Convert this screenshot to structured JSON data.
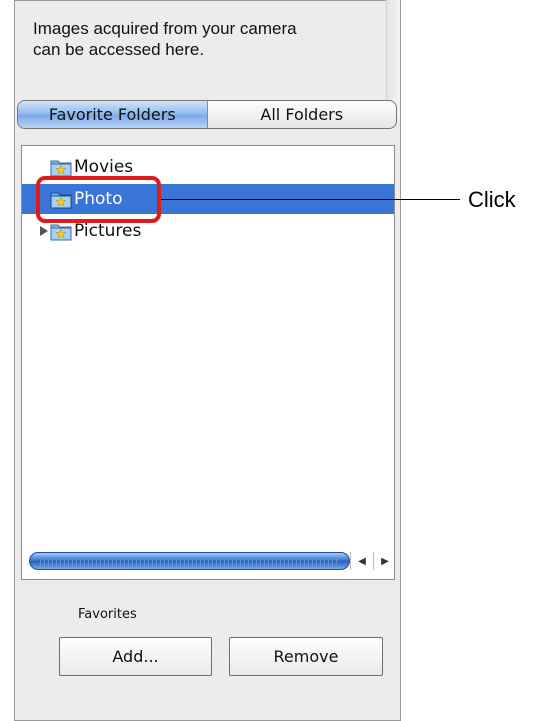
{
  "panel": {
    "info_text_line1": "Images acquired from your camera",
    "info_text_line2": "can be accessed here."
  },
  "tabs": {
    "favorite_folders": "Favorite Folders",
    "all_folders": "All Folders",
    "selected": "Favorite Folders"
  },
  "tree": {
    "items": [
      {
        "label": "Movies",
        "icon": "favorite-folder-icon",
        "selected": false,
        "expandable": false
      },
      {
        "label": "Photo",
        "icon": "favorite-folder-icon",
        "selected": true,
        "expandable": false
      },
      {
        "label": "Pictures",
        "icon": "favorite-folder-icon",
        "selected": false,
        "expandable": true
      }
    ]
  },
  "favorites": {
    "label": "Favorites",
    "add_button": "Add...",
    "remove_button": "Remove"
  },
  "callout": {
    "text": "Click"
  },
  "colors": {
    "selection": "#3875d7",
    "callout_border": "#e11b1b"
  }
}
